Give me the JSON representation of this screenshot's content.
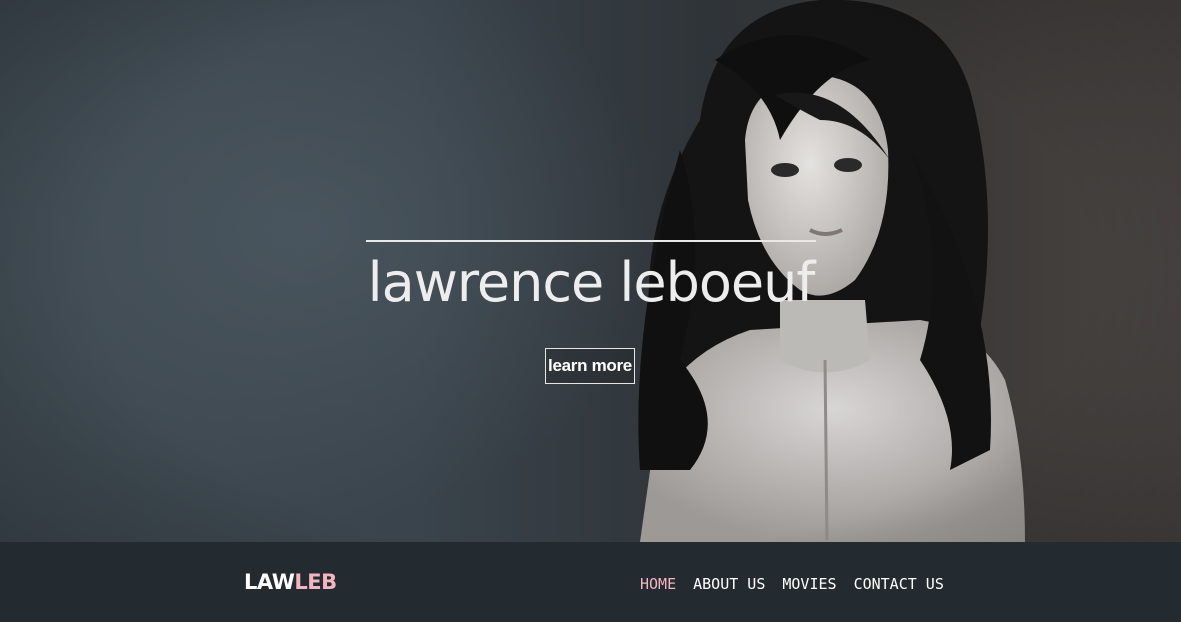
{
  "hero": {
    "title": "lawrence leboeuf",
    "cta_label": "learn more"
  },
  "brand": {
    "part1": "LAW",
    "part2": "LEB",
    "accent_color": "#f4b4c0"
  },
  "nav": {
    "items": [
      {
        "label": "HOME",
        "active": true
      },
      {
        "label": "ABOUT US",
        "active": false
      },
      {
        "label": "MOVIES",
        "active": false
      },
      {
        "label": "CONTACT US",
        "active": false
      }
    ]
  }
}
